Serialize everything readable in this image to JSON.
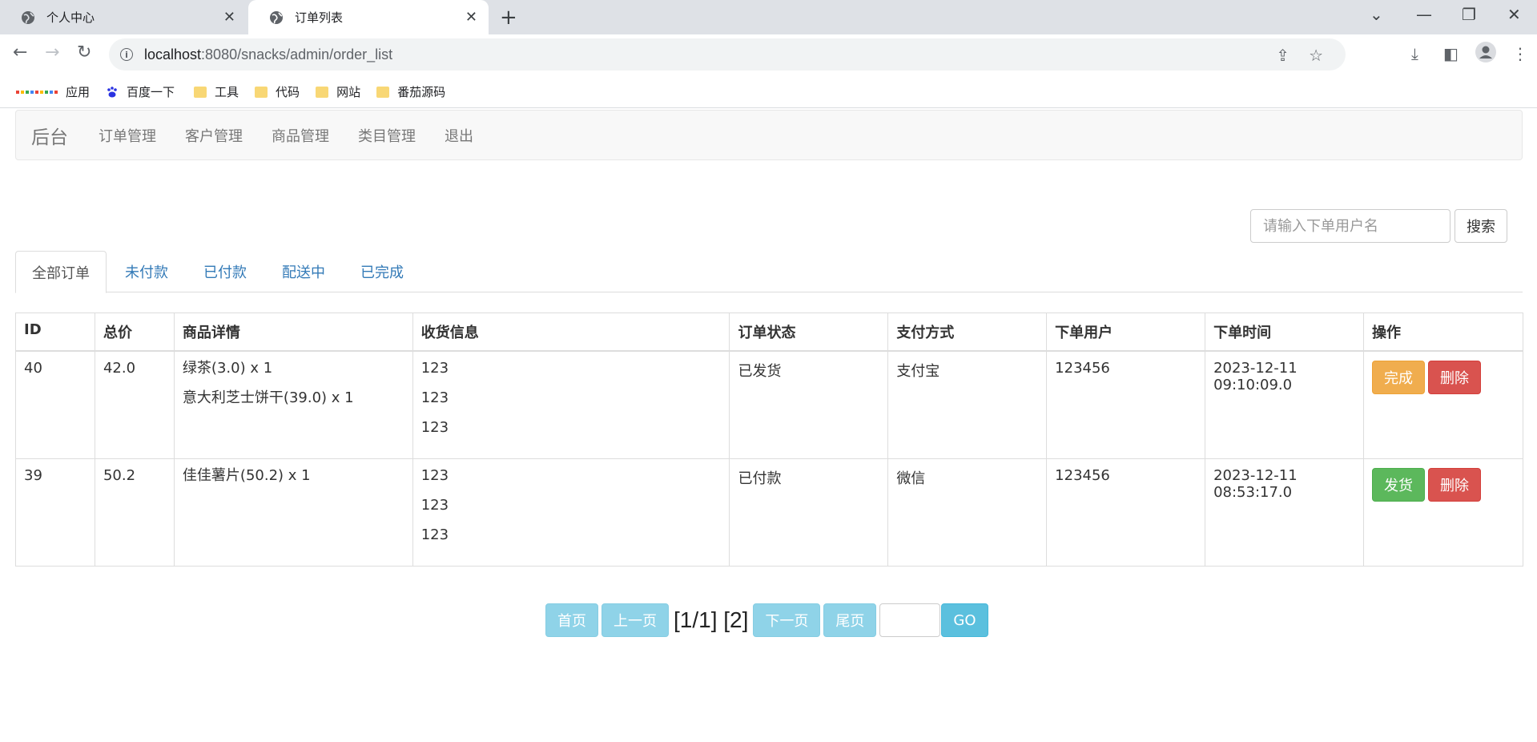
{
  "browser": {
    "tabs": [
      {
        "title": "个人中心"
      },
      {
        "title": "订单列表"
      }
    ],
    "url_host": "localhost",
    "url_rest": ":8080/snacks/admin/order_list",
    "bookmarks": [
      {
        "label": "应用"
      },
      {
        "label": "百度一下"
      },
      {
        "label": "工具"
      },
      {
        "label": "代码"
      },
      {
        "label": "网站"
      },
      {
        "label": "番茄源码"
      }
    ]
  },
  "navbar": {
    "brand": "后台",
    "links": [
      "订单管理",
      "客户管理",
      "商品管理",
      "类目管理",
      "退出"
    ]
  },
  "search": {
    "placeholder": "请输入下单用户名",
    "button": "搜索"
  },
  "status_tabs": [
    "全部订单",
    "未付款",
    "已付款",
    "配送中",
    "已完成"
  ],
  "table": {
    "headers": [
      "ID",
      "总价",
      "商品详情",
      "收货信息",
      "订单状态",
      "支付方式",
      "下单用户",
      "下单时间",
      "操作"
    ],
    "rows": [
      {
        "id": "40",
        "total": "42.0",
        "items": [
          "绿茶(3.0) x 1",
          "意大利芝士饼干(39.0) x 1"
        ],
        "shipping": [
          "123",
          "123",
          "123"
        ],
        "status": "已发货",
        "payment": "支付宝",
        "user": "123456",
        "time": "2023-12-11 09:10:09.0",
        "actions": [
          "完成",
          "删除"
        ]
      },
      {
        "id": "39",
        "total": "50.2",
        "items": [
          "佳佳薯片(50.2) x 1"
        ],
        "shipping": [
          "123",
          "123",
          "123"
        ],
        "status": "已付款",
        "payment": "微信",
        "user": "123456",
        "time": "2023-12-11 08:53:17.0",
        "actions": [
          "发货",
          "删除"
        ]
      }
    ]
  },
  "pager": {
    "first": "首页",
    "prev": "上一页",
    "info": "[1/1] [2]",
    "next": "下一页",
    "last": "尾页",
    "go": "GO"
  }
}
